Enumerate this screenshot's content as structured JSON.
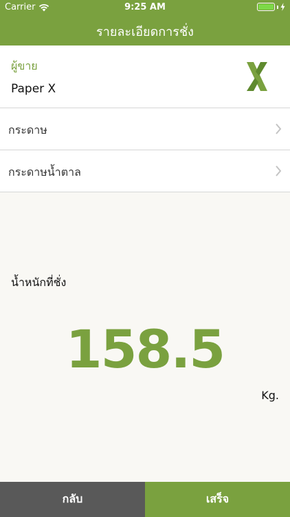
{
  "status_bar": {
    "carrier": "Carrier",
    "time": "9:25 AM",
    "wifi_icon": "wifi-icon",
    "battery_icon": "battery-icon"
  },
  "nav": {
    "title": "รายละเอียดการชั่ง"
  },
  "seller": {
    "label": "ผู้ขาย",
    "name": "Paper X",
    "logo_icon": "paper-x-logo"
  },
  "items": [
    {
      "label": "กระดาษ",
      "icon": "chevron-right-icon"
    },
    {
      "label": "กระดาษน้ำตาล",
      "icon": "chevron-right-icon"
    }
  ],
  "weight": {
    "label": "น้ำหนักที่ชั่ง",
    "value": "158.5",
    "unit": "Kg."
  },
  "buttons": {
    "back": "กลับ",
    "done": "เสร็จ"
  },
  "colors": {
    "brand_green": "#7aa13f",
    "back_button": "#595959",
    "background": "#f9f8f4"
  }
}
